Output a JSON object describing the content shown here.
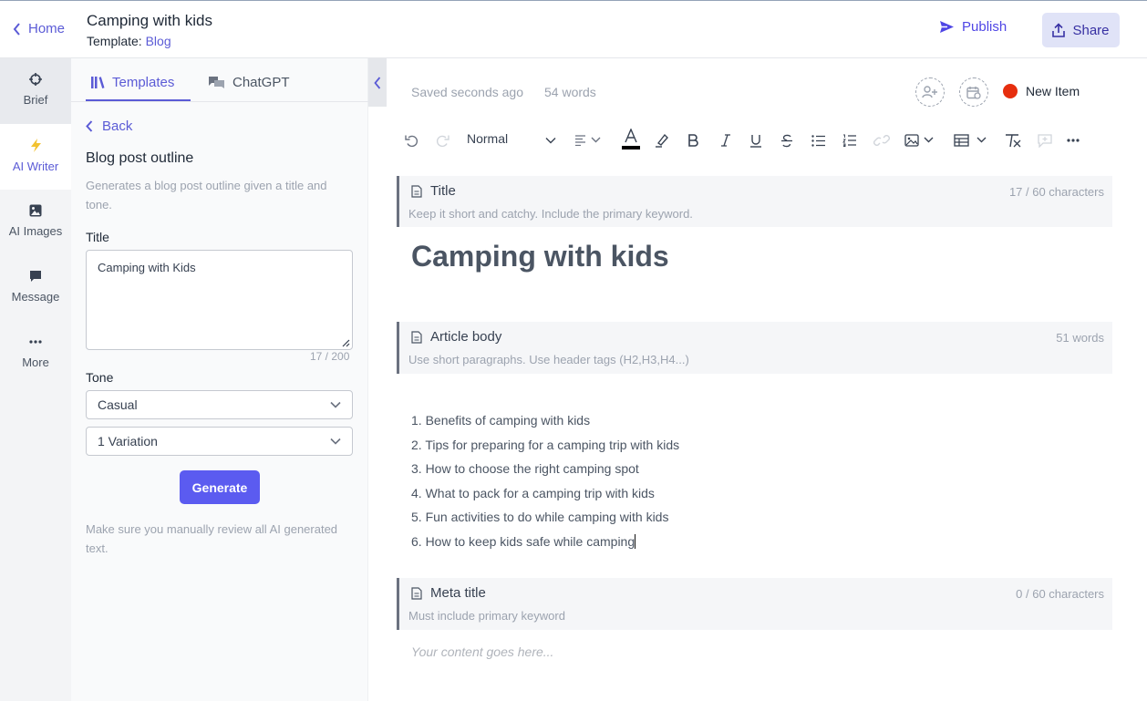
{
  "header": {
    "home_label": "Home",
    "doc_title": "Camping with kids",
    "template_prefix": "Template:",
    "template_name": "Blog",
    "publish_label": "Publish",
    "share_label": "Share"
  },
  "rail": {
    "items": [
      {
        "label": "Brief",
        "icon": "crosshair-icon"
      },
      {
        "label": "AI Writer",
        "icon": "lightning-icon"
      },
      {
        "label": "AI Images",
        "icon": "image-icon"
      },
      {
        "label": "Message",
        "icon": "chat-icon"
      },
      {
        "label": "More",
        "icon": "more-icon"
      }
    ]
  },
  "panel": {
    "tabs": [
      {
        "label": "Templates",
        "icon": "library-icon"
      },
      {
        "label": "ChatGPT",
        "icon": "chat-bubbles-icon"
      }
    ],
    "back_label": "Back",
    "heading": "Blog post outline",
    "description": "Generates a blog post outline given a title and tone.",
    "title_label": "Title",
    "title_value": "Camping with Kids",
    "title_counter": "17 / 200",
    "tone_label": "Tone",
    "tone_value": "Casual",
    "variation_value": "1 Variation",
    "generate_label": "Generate",
    "note": "Make sure you manually review all AI generated text."
  },
  "editor": {
    "saved_status": "Saved seconds ago",
    "word_count": "54 words",
    "status_label": "New Item",
    "status_color": "#e62e0e",
    "toolbar_format": "Normal",
    "sections": {
      "title": {
        "label": "Title",
        "hint": "Keep it short and catchy. Include the primary keyword.",
        "count": "17 / 60 characters"
      },
      "body": {
        "label": "Article body",
        "hint": "Use short paragraphs. Use header tags (H2,H3,H4...)",
        "count": "51 words"
      },
      "meta": {
        "label": "Meta title",
        "hint": "Must include primary keyword",
        "count": "0 / 60 characters"
      }
    },
    "title_text": "Camping with kids",
    "outline": [
      "1. Benefits of camping with kids",
      "2. Tips for preparing for a camping trip with kids",
      "3. How to choose the right camping spot",
      "4. What to pack for a camping trip with kids",
      "5. Fun activities to do while camping with kids",
      "6. How to keep kids safe while camping"
    ],
    "meta_placeholder": "Your content goes here..."
  },
  "colors": {
    "accent": "#5b5bd6",
    "generate_button": "#5b5bf0",
    "share_bg": "#e0e3f7"
  }
}
